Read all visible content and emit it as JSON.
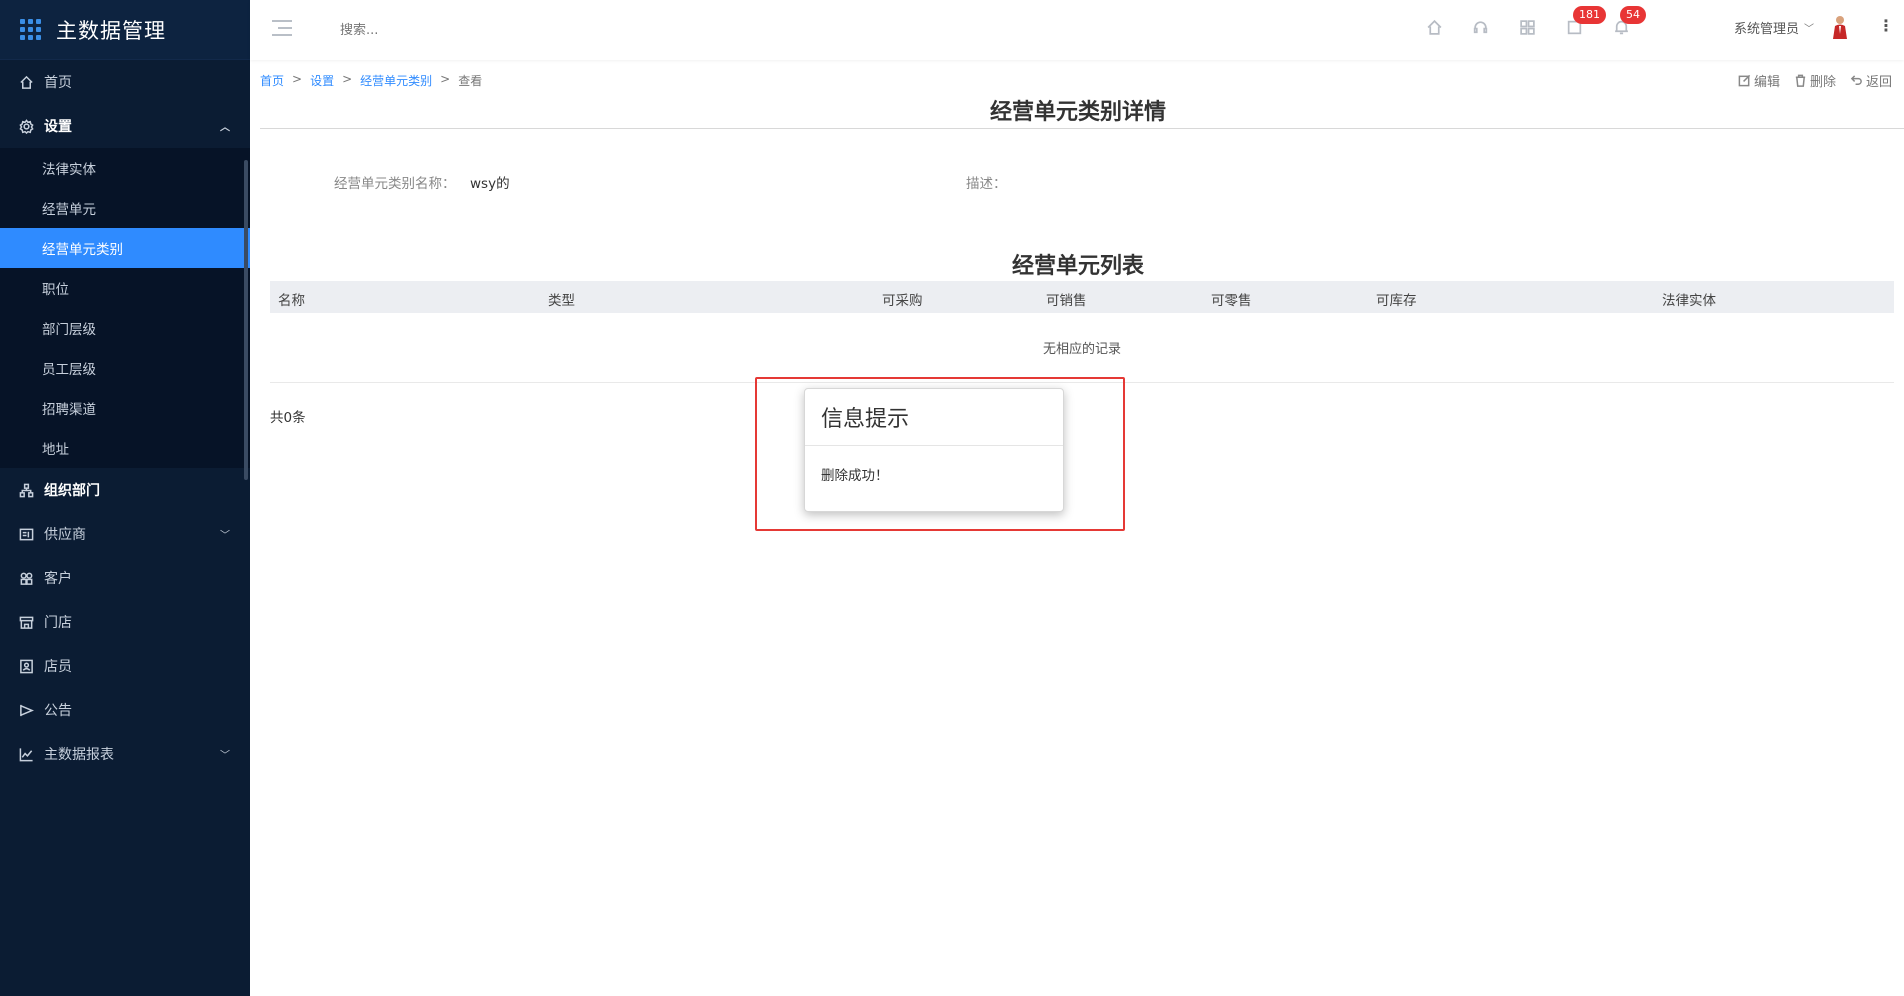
{
  "app": {
    "title": "主数据管理"
  },
  "sidebar": {
    "items": [
      {
        "label": "首页"
      },
      {
        "label": "设置",
        "expanded": true,
        "children": [
          {
            "label": "法律实体"
          },
          {
            "label": "经营单元"
          },
          {
            "label": "经营单元类别",
            "active": true
          },
          {
            "label": "职位"
          },
          {
            "label": "部门层级"
          },
          {
            "label": "员工层级"
          },
          {
            "label": "招聘渠道"
          },
          {
            "label": "地址"
          }
        ]
      },
      {
        "label": "组织部门"
      },
      {
        "label": "供应商"
      },
      {
        "label": "客户"
      },
      {
        "label": "门店"
      },
      {
        "label": "店员"
      },
      {
        "label": "公告"
      },
      {
        "label": "主数据报表"
      }
    ]
  },
  "header": {
    "search_placeholder": "搜索...",
    "badges": {
      "messages": "181",
      "notifications": "54"
    },
    "user": "系统管理员"
  },
  "breadcrumb": {
    "home": "首页",
    "settings": "设置",
    "category": "经营单元类别",
    "current": "查看"
  },
  "actions": {
    "edit": "编辑",
    "delete": "删除",
    "back": "返回"
  },
  "detail": {
    "title": "经营单元类别详情",
    "name_label": "经营单元类别名称：",
    "name_value": "wsy的",
    "desc_label": "描述："
  },
  "list": {
    "title": "经营单元列表",
    "columns": [
      "名称",
      "类型",
      "可采购",
      "可销售",
      "可零售",
      "可库存",
      "法律实体"
    ],
    "empty_text": "无相应的记录",
    "total": "共0条"
  },
  "dialog": {
    "title": "信息提示",
    "message": "删除成功！"
  },
  "colors": {
    "sidebar_bg": "#0b1c33",
    "active": "#2f8bff",
    "badge": "#e83535",
    "highlight": "#e53935"
  }
}
